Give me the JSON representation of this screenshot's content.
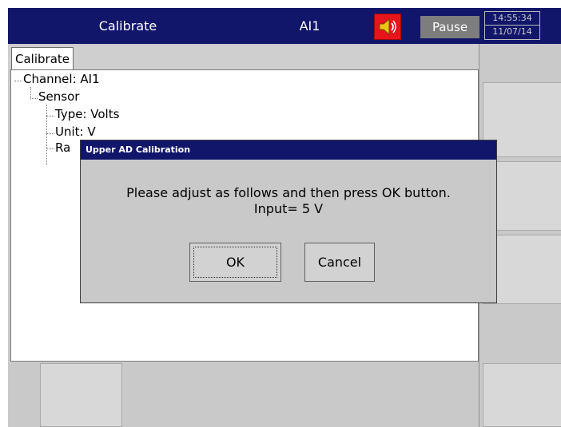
{
  "header": {
    "screen_title": "Calibrate",
    "channel": "AI1",
    "mode": "Pause",
    "time": "14:55:34",
    "date": "11/07/14",
    "speaker_icon": "speaker-icon",
    "colors": {
      "bar": "#11166a",
      "speaker": "#e8141c"
    }
  },
  "panel": {
    "tab_label": "Calibrate",
    "tree": {
      "channel": "Channel: AI1",
      "sensor": "Sensor",
      "type": "Type: Volts",
      "unit": "Unit: V",
      "range_partial": "Ra"
    }
  },
  "dialog": {
    "title": "Upper AD Calibration",
    "message_line1": "Please adjust as follows and then press OK button.",
    "message_line2": "Input= 5 V",
    "ok_label": "OK",
    "cancel_label": "Cancel"
  }
}
